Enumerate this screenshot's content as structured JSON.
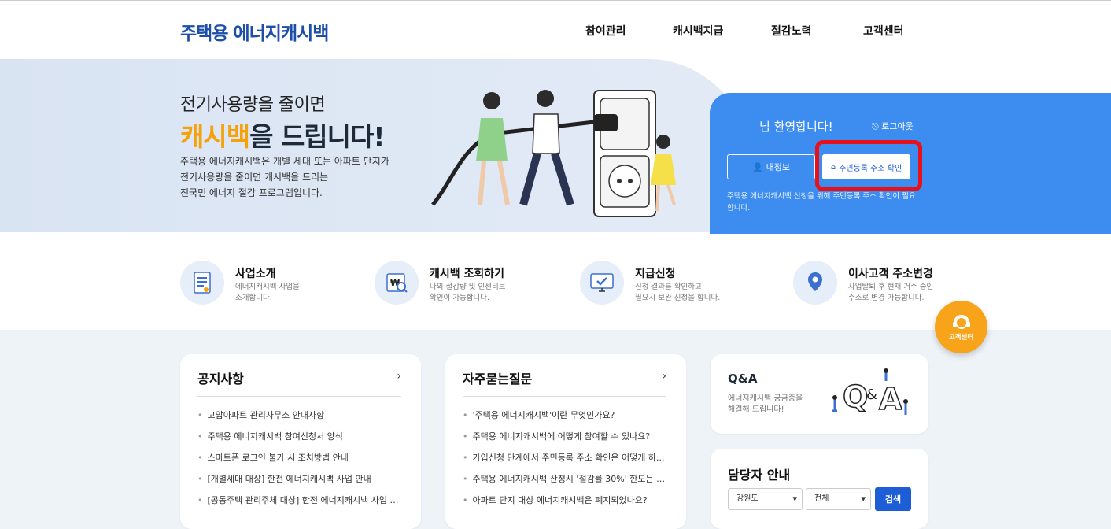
{
  "header": {
    "logo": "주택용 에너지캐시백",
    "nav": [
      "참여관리",
      "캐시백지급",
      "절감노력",
      "고객센터"
    ]
  },
  "hero": {
    "subtitle": "전기사용량을 줄이면",
    "title_highlight": "캐시백",
    "title_rest": "을 드립니다!",
    "description": "주택용 에너지캐시백은 개별 세대 또는 아파트 단지가\n전기사용량을 줄이면 캐시백을 드리는\n전국민 에너지 절감 프로그램입니다."
  },
  "panel": {
    "welcome": "님 환영합니다!",
    "logout": "로그아웃",
    "my_info": "내정보",
    "address_check": "주민등록 주소 확인",
    "note": "주택용 에너지캐시백 신청을 위해 주민등록 주소 확인이 필요합니다."
  },
  "quick_menu": [
    {
      "title": "사업소개",
      "desc": "에너지캐시백 사업을\n소개합니다.",
      "icon": "document-list-icon"
    },
    {
      "title": "캐시백 조회하기",
      "desc": "나의 절감량 및 인센티브\n확인이 가능합니다.",
      "icon": "won-search-icon"
    },
    {
      "title": "지급신청",
      "desc": "신청 결과를 확인하고\n필요시 보완 신청을 합니다.",
      "icon": "monitor-check-icon"
    },
    {
      "title": "이사고객 주소변경",
      "desc": "사업탈퇴 후 현재 거주 중인\n주소로 변경 가능합니다.",
      "icon": "map-pin-icon"
    }
  ],
  "fab": {
    "label": "고객센터",
    "icon": "headset-icon"
  },
  "notice": {
    "title": "공지사항",
    "more": "›",
    "items": [
      "고압아파트 관리사무소 안내사항",
      "주택용 에너지캐시백 참여신청서 양식",
      "스마트폰 로그인 불가 시 조치방법 안내",
      "[개별세대 대상] 한전 에너지캐시백 사업 안내",
      "[공동주택 관리주체 대상] 한전 에너지캐시백 사업 안..."
    ]
  },
  "faq": {
    "title": "자주묻는질문",
    "more": "›",
    "items": [
      "'주택용 에너지캐시백'이란 무엇인가요?",
      "주택용 에너지캐시백에 어떻게 참여할 수 있나요?",
      "가입신청 단계에서 주민등록 주소 확인은 어떻게 하...",
      "주택용 에너지캐시백 산정시 '절감률 30%' 한도는 왜...",
      "아파트 단지 대상 에너지캐시백은 폐지되었나요?"
    ]
  },
  "qa": {
    "title": "Q&A",
    "desc": "에너지캐시백 궁금증을\n해결해 드립니다!"
  },
  "manager": {
    "title": "담당자 안내",
    "region": "강원도",
    "area": "전체",
    "search": "검색"
  },
  "colors": {
    "brand": "#1d4fa8",
    "accent": "#f5a20a",
    "panel": "#3d8cf0",
    "highlight_box": "#e8111a"
  }
}
